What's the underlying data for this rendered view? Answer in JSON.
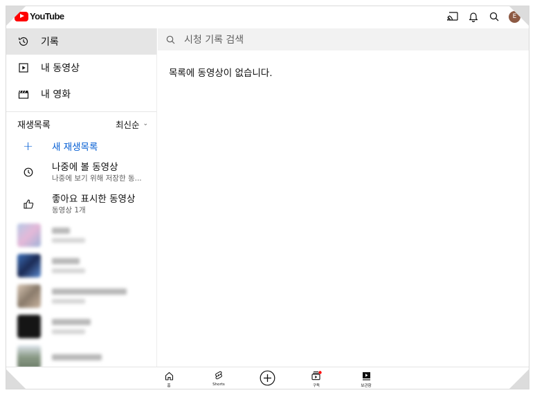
{
  "app": {
    "logo_text": "YouTube"
  },
  "header": {
    "icons": [
      "cast-icon",
      "bell-icon",
      "search-icon"
    ],
    "avatar_letter": "E"
  },
  "sidebar": {
    "nav": [
      {
        "label": "기록",
        "icon": "history-icon",
        "active": true
      },
      {
        "label": "내 동영상",
        "icon": "play-square-icon",
        "active": false
      },
      {
        "label": "내 영화",
        "icon": "clapperboard-icon",
        "active": false
      }
    ],
    "playlists_header": "재생목록",
    "sort_label": "최신순",
    "new_playlist": "새 재생목록",
    "playlists": [
      {
        "title": "나중에 볼 동영상",
        "subtitle": "나중에 보기 위해 저장한 동...",
        "icon": "clock-icon"
      },
      {
        "title": "좋아요 표시한 동영상",
        "subtitle": "동영상 1개",
        "icon": "thumbs-up-icon"
      }
    ]
  },
  "main": {
    "search_placeholder": "시청 기록 검색",
    "empty_message": "목록에 동영상이 없습니다."
  },
  "bottom_nav": {
    "items": [
      {
        "label": "홈",
        "icon": "home-icon"
      },
      {
        "label": "Shorts",
        "icon": "shorts-icon"
      },
      {
        "label": "",
        "icon": "create-plus-icon"
      },
      {
        "label": "구독",
        "icon": "subscriptions-icon"
      },
      {
        "label": "보관함",
        "icon": "library-icon"
      }
    ]
  },
  "colors": {
    "brand_red": "#ff0000",
    "link_blue": "#065fd4",
    "active_bg": "#e5e5e5",
    "avatar_bg": "#8d5a44"
  }
}
